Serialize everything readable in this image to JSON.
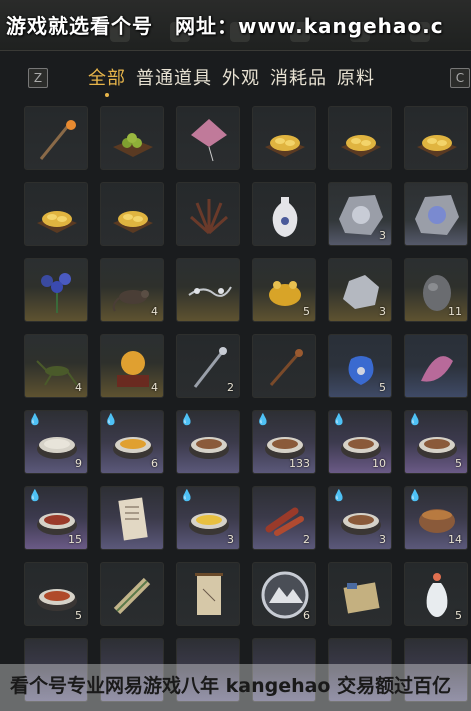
{
  "watermark_top": {
    "left": "游戏就选看个号",
    "right": "网址：www.kangehao.c"
  },
  "hotkeys": {
    "prev": "Z",
    "next": "C"
  },
  "tabs": [
    {
      "label": "全部",
      "active": true
    },
    {
      "label": "普通道具",
      "active": false
    },
    {
      "label": "外观",
      "active": false
    },
    {
      "label": "消耗品",
      "active": false
    },
    {
      "label": "原料",
      "active": false
    }
  ],
  "rarity_colors": {
    "bronze": "#5e5230",
    "blue": "#3f4a66",
    "gray": "#55596a",
    "purple": "#6a5a86",
    "lilac": "#5b587a"
  },
  "grid": [
    [
      {
        "icon": "staff-lantern-icon",
        "count": "",
        "rarity": "dark"
      },
      {
        "icon": "green-fruit-plate-icon",
        "count": "",
        "rarity": "dark"
      },
      {
        "icon": "pink-kite-icon",
        "count": "",
        "rarity": "dark"
      },
      {
        "icon": "gold-ingot-tray-icon",
        "count": "",
        "rarity": "dark"
      },
      {
        "icon": "gold-ingot-tray-icon",
        "count": "",
        "rarity": "dark"
      },
      {
        "icon": "gold-ingot-tray-icon",
        "count": "",
        "rarity": "dark"
      }
    ],
    [
      {
        "icon": "gold-ingot-tray-icon",
        "count": "",
        "rarity": "dark"
      },
      {
        "icon": "gold-ingot-tray-icon",
        "count": "",
        "rarity": "dark"
      },
      {
        "icon": "dark-herb-icon",
        "count": "",
        "rarity": "dark"
      },
      {
        "icon": "white-vase-icon",
        "count": "",
        "rarity": "dark"
      },
      {
        "icon": "marble-stone-icon",
        "count": "3",
        "rarity": "gray"
      },
      {
        "icon": "blue-crystal-stone-icon",
        "count": "",
        "rarity": "gray"
      }
    ],
    [
      {
        "icon": "blue-flower-icon",
        "count": "",
        "rarity": "bronze"
      },
      {
        "icon": "rat-icon",
        "count": "4",
        "rarity": "bronze"
      },
      {
        "icon": "silver-branch-icon",
        "count": "",
        "rarity": "bronze"
      },
      {
        "icon": "golden-toad-icon",
        "count": "5",
        "rarity": "bronze"
      },
      {
        "icon": "silver-ore-icon",
        "count": "3",
        "rarity": "bronze"
      },
      {
        "icon": "dark-ore-icon",
        "count": "11",
        "rarity": "bronze"
      }
    ],
    [
      {
        "icon": "cricket-icon",
        "count": "4",
        "rarity": "bronze"
      },
      {
        "icon": "golden-orb-icon",
        "count": "4",
        "rarity": "bronze"
      },
      {
        "icon": "silver-staff-icon",
        "count": "2",
        "rarity": "dark"
      },
      {
        "icon": "hairpin-icon",
        "count": "",
        "rarity": "dark"
      },
      {
        "icon": "blue-pouch-icon",
        "count": "5",
        "rarity": "blue"
      },
      {
        "icon": "yarn-icon",
        "count": "",
        "rarity": "blue"
      }
    ],
    [
      {
        "icon": "rice-bowl-icon",
        "count": "9",
        "rarity": "lilac",
        "drop": true
      },
      {
        "icon": "egg-soup-icon",
        "count": "6",
        "rarity": "lilac",
        "drop": true
      },
      {
        "icon": "stew-bowl-icon",
        "count": "",
        "rarity": "lilac",
        "drop": true
      },
      {
        "icon": "meat-dish-icon",
        "count": "133",
        "rarity": "lilac",
        "drop": true
      },
      {
        "icon": "fish-plate-icon",
        "count": "10",
        "rarity": "purple",
        "drop": true
      },
      {
        "icon": "fish-plate-icon",
        "count": "5",
        "rarity": "purple",
        "drop": true
      }
    ],
    [
      {
        "icon": "beef-bowl-icon",
        "count": "15",
        "rarity": "purple",
        "drop": true
      },
      {
        "icon": "letter-paper-icon",
        "count": "",
        "rarity": "lilac"
      },
      {
        "icon": "egg-plate-icon",
        "count": "3",
        "rarity": "lilac",
        "drop": true
      },
      {
        "icon": "sausage-icon",
        "count": "2",
        "rarity": "lilac"
      },
      {
        "icon": "fried-dish-icon",
        "count": "3",
        "rarity": "lilac",
        "drop": true
      },
      {
        "icon": "clay-pot-icon",
        "count": "14",
        "rarity": "lilac",
        "drop": true
      }
    ],
    [
      {
        "icon": "noodle-bowl-icon",
        "count": "5",
        "rarity": "dark"
      },
      {
        "icon": "scroll-bundle-icon",
        "count": "",
        "rarity": "dark"
      },
      {
        "icon": "hanging-scroll-icon",
        "count": "",
        "rarity": "dark"
      },
      {
        "icon": "mountain-token-icon",
        "count": "6",
        "rarity": "dark"
      },
      {
        "icon": "cloth-book-icon",
        "count": "",
        "rarity": "dark"
      },
      {
        "icon": "flower-vase-icon",
        "count": "5",
        "rarity": "dark"
      }
    ]
  ],
  "watermark_bottom": "看个号专业网易游戏八年 kangehao 交易额过百亿"
}
